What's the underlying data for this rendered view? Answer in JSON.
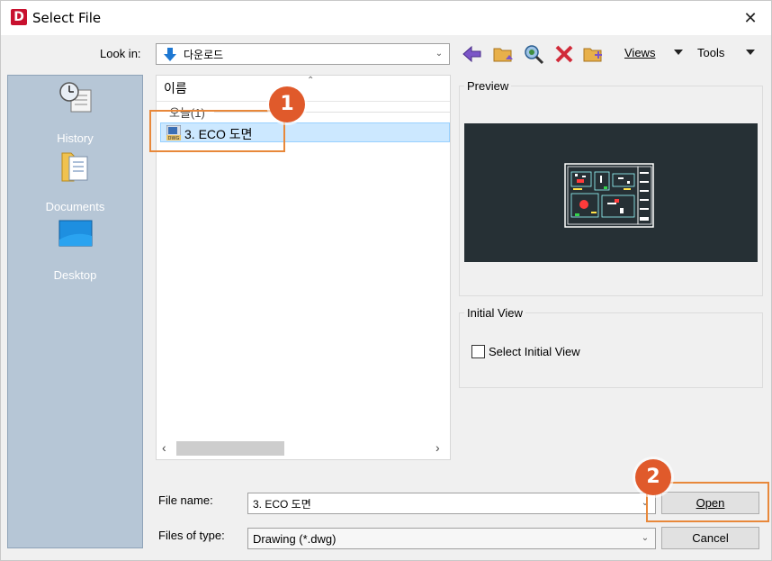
{
  "window": {
    "title": "Select File",
    "close_glyph": "✕"
  },
  "toolbar": {
    "look_in_label": "Look in:",
    "look_in_value": "다운로드",
    "views_label": "Views",
    "tools_label": "Tools",
    "icons": [
      "back-arrow-icon",
      "up-folder-icon",
      "search-web-icon",
      "delete-icon",
      "new-folder-icon"
    ]
  },
  "places": [
    {
      "label": "History",
      "icon": "history-icon"
    },
    {
      "label": "Documents",
      "icon": "documents-icon"
    },
    {
      "label": "Desktop",
      "icon": "desktop-icon"
    }
  ],
  "file_list": {
    "column_header": "이름",
    "group_label": "오늘(1)",
    "files": [
      {
        "name": "3. ECO 도면",
        "icon": "dwg-file-icon",
        "selected": true
      }
    ]
  },
  "preview": {
    "title": "Preview"
  },
  "initial_view": {
    "title": "Initial View",
    "checkbox_label": "Select Initial View",
    "checked": false
  },
  "file_name": {
    "label": "File name:",
    "value": "3. ECO 도면"
  },
  "files_of_type": {
    "label": "Files of type:",
    "value": "Drawing (*.dwg)"
  },
  "buttons": {
    "open": "Open",
    "cancel": "Cancel"
  },
  "annotations": {
    "step1": "1",
    "step2": "2",
    "color": "#e05a2b"
  }
}
